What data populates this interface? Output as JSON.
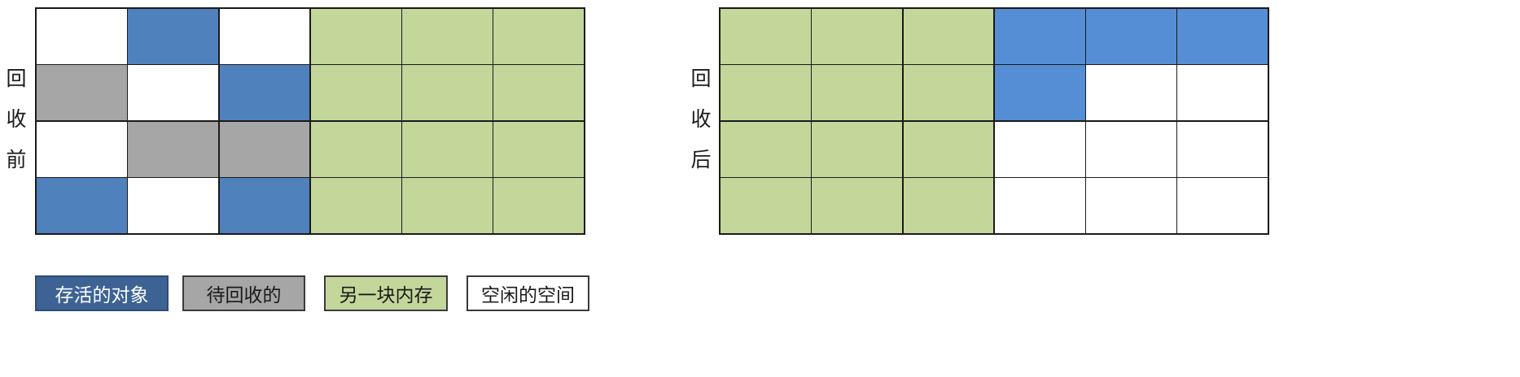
{
  "colors": {
    "alive_before": "#4f81bd",
    "alive_after": "#558ed5",
    "garbage": "#a6a6a6",
    "copy_area": "#c4d79b",
    "free": "#ffffff",
    "legend_alive": "#3d6394"
  },
  "before": {
    "label_chars": [
      "回",
      "收",
      "前"
    ],
    "rows": [
      [
        "free",
        "alive",
        "free",
        "copy",
        "copy",
        "copy"
      ],
      [
        "garbage",
        "free",
        "alive",
        "copy",
        "copy",
        "copy"
      ],
      [
        "free",
        "garbage",
        "garbage",
        "copy",
        "copy",
        "copy"
      ],
      [
        "alive",
        "free",
        "alive",
        "copy",
        "copy",
        "copy"
      ]
    ]
  },
  "after": {
    "label_chars": [
      "回",
      "收",
      "后"
    ],
    "rows": [
      [
        "copy",
        "copy",
        "copy",
        "alive",
        "alive",
        "alive"
      ],
      [
        "copy",
        "copy",
        "copy",
        "alive",
        "free",
        "free"
      ],
      [
        "copy",
        "copy",
        "copy",
        "free",
        "free",
        "free"
      ],
      [
        "copy",
        "copy",
        "copy",
        "free",
        "free",
        "free"
      ]
    ]
  },
  "legend": {
    "alive": "存活的对象",
    "garbage": "待回收的",
    "copy": "另一块内存",
    "free": "空闲的空间"
  }
}
